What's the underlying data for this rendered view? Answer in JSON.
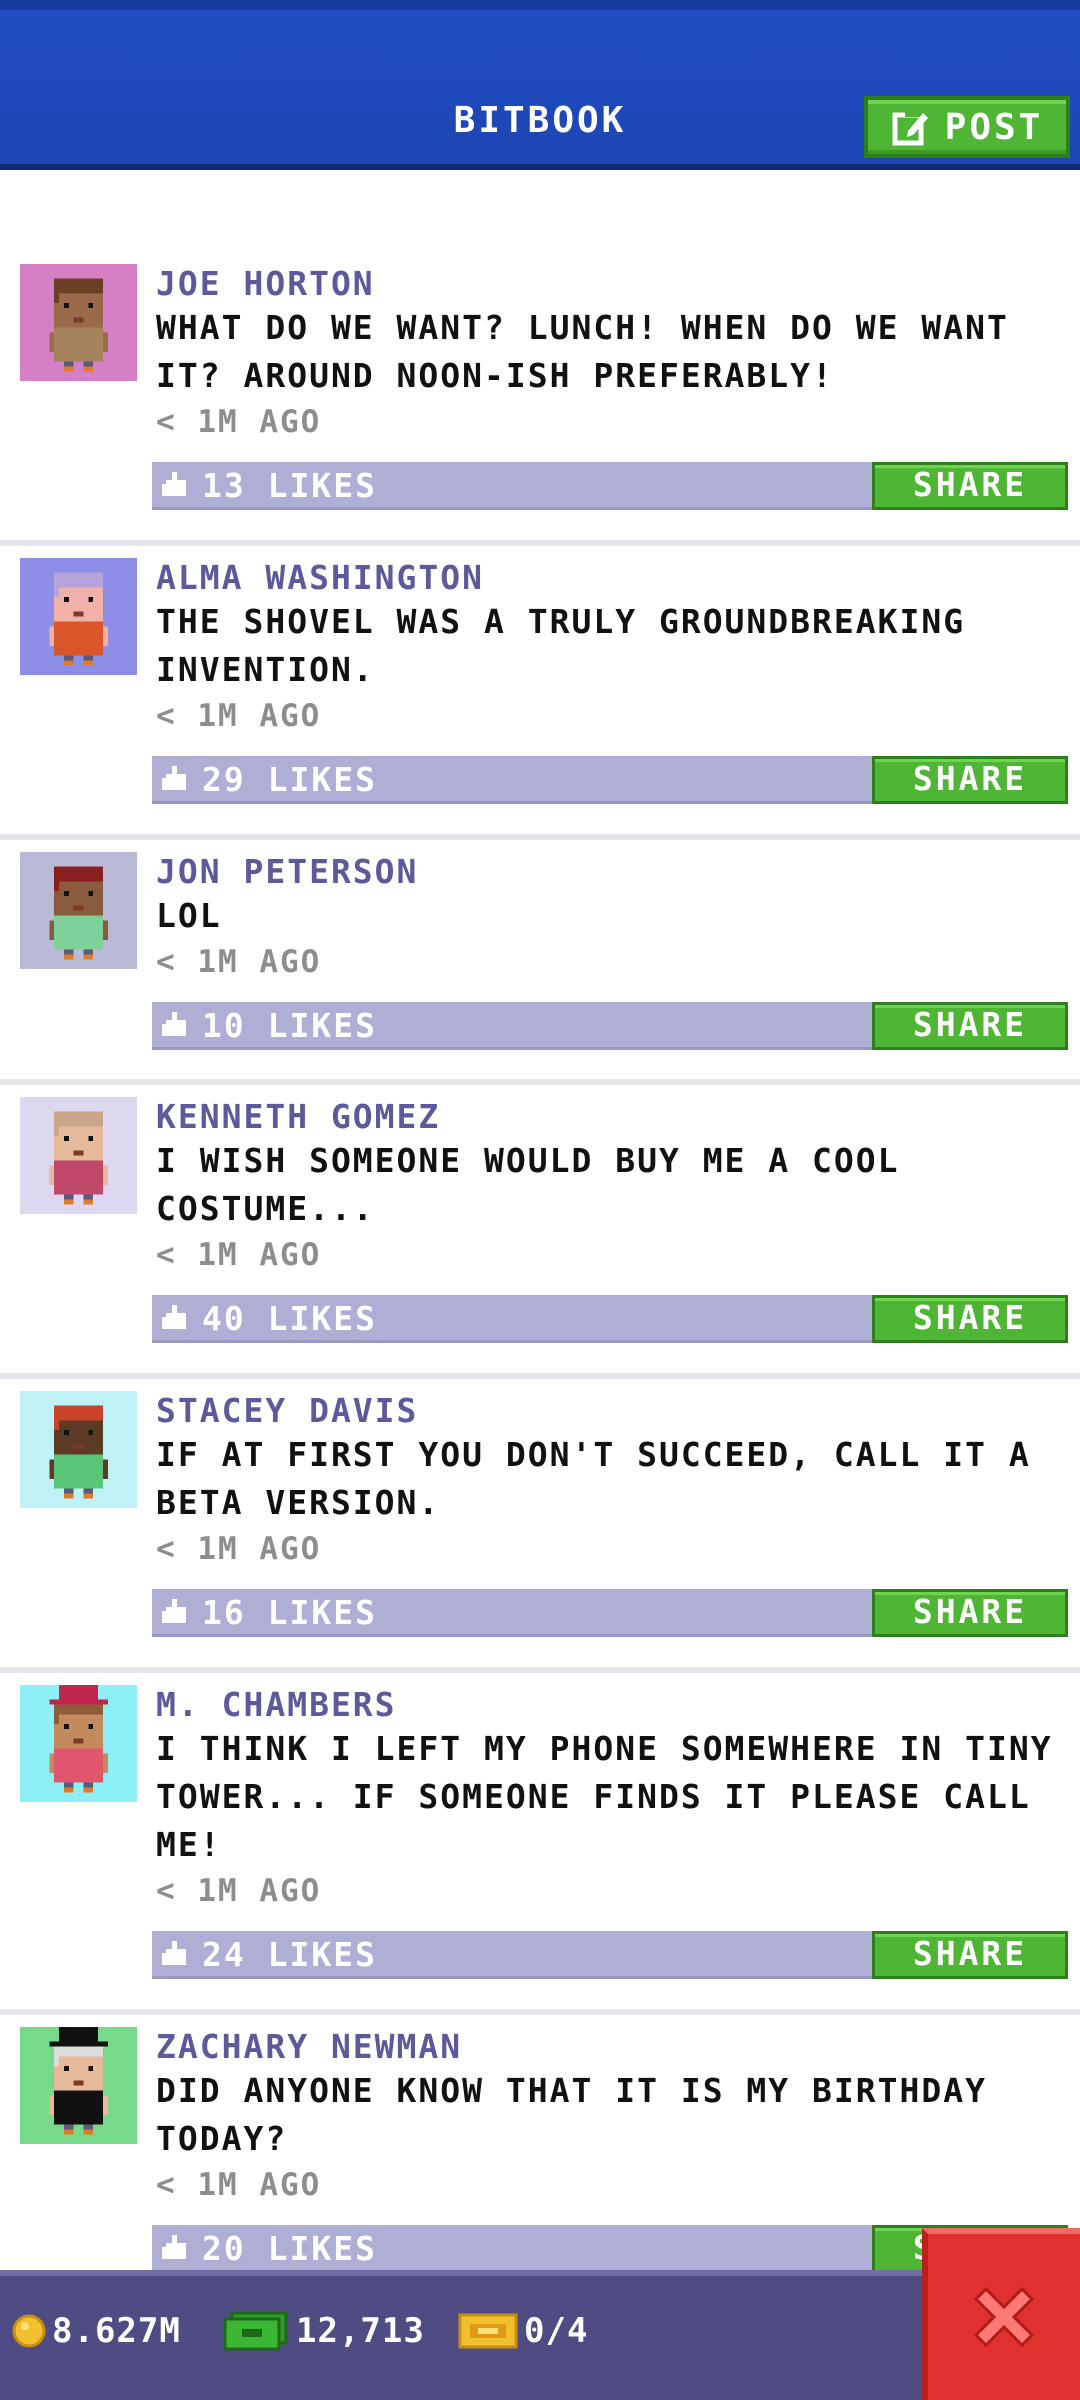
{
  "header": {
    "title": "BITBOOK",
    "post_label": "POST"
  },
  "posts": [
    {
      "author": "JOE HORTON",
      "message": "WHAT DO WE WANT? LUNCH! WHEN DO WE WANT IT? AROUND NOON-ISH PREFERABLY!",
      "time": "< 1M AGO",
      "likes": "13 LIKES",
      "share_label": "SHARE",
      "avatar_bg": "#d47fc6",
      "skin": "#9a6a4a",
      "hair": "#6b3f25",
      "shirt": "#a5835a",
      "hat": ""
    },
    {
      "author": "ALMA WASHINGTON",
      "message": "THE SHOVEL WAS A TRULY GROUNDBREAKING INVENTION.",
      "time": "< 1M AGO",
      "likes": "29 LIKES",
      "share_label": "SHARE",
      "avatar_bg": "#8d8ee8",
      "skin": "#f2b1a8",
      "hair": "#b7a3d9",
      "shirt": "#d9562b",
      "hat": ""
    },
    {
      "author": "JON PETERSON",
      "message": "LOL",
      "time": "< 1M AGO",
      "likes": "10 LIKES",
      "share_label": "SHARE",
      "avatar_bg": "#b9b9d8",
      "skin": "#8a5a3c",
      "hair": "#8a1f1f",
      "shirt": "#7fd19a",
      "hat": ""
    },
    {
      "author": "KENNETH GOMEZ",
      "message": "I WISH SOMEONE WOULD BUY ME A COOL COSTUME...",
      "time": "< 1M AGO",
      "likes": "40 LIKES",
      "share_label": "SHARE",
      "avatar_bg": "#ddd7ef",
      "skin": "#e6b99a",
      "hair": "#c9a58a",
      "shirt": "#c0486a",
      "hat": ""
    },
    {
      "author": "STACEY DAVIS",
      "message": "IF AT FIRST YOU DON'T SUCCEED, CALL IT A BETA VERSION.",
      "time": "< 1M AGO",
      "likes": "16 LIKES",
      "share_label": "SHARE",
      "avatar_bg": "#bff1f7",
      "skin": "#5c3a24",
      "hair": "#c8432a",
      "shirt": "#59c576",
      "hat": ""
    },
    {
      "author": "M. CHAMBERS",
      "message": "I THINK I LEFT MY PHONE SOMEWHERE IN TINY TOWER... IF SOMEONE FINDS IT PLEASE CALL ME!",
      "time": "< 1M AGO",
      "likes": "24 LIKES",
      "share_label": "SHARE",
      "avatar_bg": "#8ef0f7",
      "skin": "#c48a5e",
      "hair": "#8d5b3a",
      "shirt": "#e0566c",
      "hat": "#c0254a"
    },
    {
      "author": "ZACHARY NEWMAN",
      "message": "DID ANYONE KNOW THAT IT IS MY BIRTHDAY TODAY?",
      "time": "< 1M AGO",
      "likes": "20 LIKES",
      "share_label": "SHARE",
      "avatar_bg": "#77d98a",
      "skin": "#e6b99a",
      "hair": "#dddddd",
      "shirt": "#111111",
      "hat": "#111111"
    }
  ],
  "status": {
    "coins": "8.627M",
    "bux": "12,713",
    "tickets": "0/4"
  },
  "colors": {
    "header_blue": "#1f4fc4",
    "share_green": "#4fb535",
    "like_bar": "#afaed5",
    "author_purple": "#5d5a9c",
    "close_red": "#e0312f"
  },
  "icons": {
    "post": "edit-icon",
    "like": "thumbs-up-icon",
    "coins": "coin-icon",
    "bux": "bux-icon",
    "tickets": "ticket-icon",
    "close": "close-icon"
  }
}
